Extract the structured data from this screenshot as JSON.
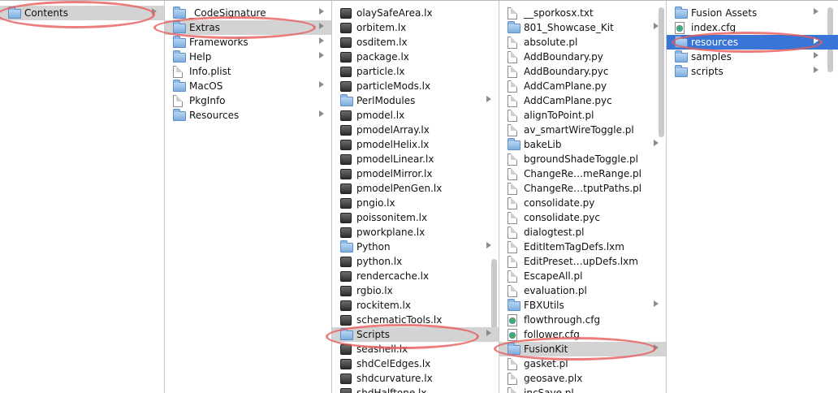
{
  "columns": [
    {
      "items": [
        {
          "label": "Contents",
          "icon": "folder-icon",
          "arrow": true,
          "selected": "gray"
        }
      ]
    },
    {
      "items": [
        {
          "label": "_CodeSignature",
          "icon": "folder-icon",
          "arrow": true
        },
        {
          "label": "Extras",
          "icon": "folder-icon",
          "arrow": true,
          "selected": "gray"
        },
        {
          "label": "Frameworks",
          "icon": "folder-icon",
          "arrow": true
        },
        {
          "label": "Help",
          "icon": "folder-icon",
          "arrow": true
        },
        {
          "label": "Info.plist",
          "icon": "doc-icon"
        },
        {
          "label": "MacOS",
          "icon": "folder-icon",
          "arrow": true
        },
        {
          "label": "PkgInfo",
          "icon": "doc-icon"
        },
        {
          "label": "Resources",
          "icon": "folder-icon",
          "arrow": true
        }
      ]
    },
    {
      "items": [
        {
          "label": "olaySafeArea.lx",
          "icon": "lx-icon"
        },
        {
          "label": "orbitem.lx",
          "icon": "lx-icon"
        },
        {
          "label": "osditem.lx",
          "icon": "lx-icon"
        },
        {
          "label": "package.lx",
          "icon": "lx-icon"
        },
        {
          "label": "particle.lx",
          "icon": "lx-icon"
        },
        {
          "label": "particleMods.lx",
          "icon": "lx-icon"
        },
        {
          "label": "PerlModules",
          "icon": "folder-icon",
          "arrow": true
        },
        {
          "label": "pmodel.lx",
          "icon": "lx-icon"
        },
        {
          "label": "pmodelArray.lx",
          "icon": "lx-icon"
        },
        {
          "label": "pmodelHelix.lx",
          "icon": "lx-icon"
        },
        {
          "label": "pmodelLinear.lx",
          "icon": "lx-icon"
        },
        {
          "label": "pmodelMirror.lx",
          "icon": "lx-icon"
        },
        {
          "label": "pmodelPenGen.lx",
          "icon": "lx-icon"
        },
        {
          "label": "pngio.lx",
          "icon": "lx-icon"
        },
        {
          "label": "poissonitem.lx",
          "icon": "lx-icon"
        },
        {
          "label": "pworkplane.lx",
          "icon": "lx-icon"
        },
        {
          "label": "Python",
          "icon": "folder-icon",
          "arrow": true
        },
        {
          "label": "python.lx",
          "icon": "lx-icon"
        },
        {
          "label": "rendercache.lx",
          "icon": "lx-icon"
        },
        {
          "label": "rgbio.lx",
          "icon": "lx-icon"
        },
        {
          "label": "rockitem.lx",
          "icon": "lx-icon"
        },
        {
          "label": "schematicTools.lx",
          "icon": "lx-icon"
        },
        {
          "label": "Scripts",
          "icon": "folder-icon",
          "arrow": true,
          "selected": "gray"
        },
        {
          "label": "seashell.lx",
          "icon": "lx-icon"
        },
        {
          "label": "shdCelEdges.lx",
          "icon": "lx-icon"
        },
        {
          "label": "shdcurvature.lx",
          "icon": "lx-icon"
        },
        {
          "label": "shdHalftone.lx",
          "icon": "lx-icon"
        }
      ]
    },
    {
      "items": [
        {
          "label": "__sporkosx.txt",
          "icon": "doc-icon"
        },
        {
          "label": "801_Showcase_Kit",
          "icon": "folder-icon",
          "arrow": true
        },
        {
          "label": "absolute.pl",
          "icon": "doc-icon"
        },
        {
          "label": "AddBoundary.py",
          "icon": "doc-icon"
        },
        {
          "label": "AddBoundary.pyc",
          "icon": "doc-icon"
        },
        {
          "label": "AddCamPlane.py",
          "icon": "doc-icon"
        },
        {
          "label": "AddCamPlane.pyc",
          "icon": "doc-icon"
        },
        {
          "label": "alignToPoint.pl",
          "icon": "doc-icon"
        },
        {
          "label": "av_smartWireToggle.pl",
          "icon": "doc-icon"
        },
        {
          "label": "bakeLib",
          "icon": "folder-icon",
          "arrow": true
        },
        {
          "label": "bgroundShadeToggle.pl",
          "icon": "doc-icon"
        },
        {
          "label": "ChangeRe…meRange.pl",
          "icon": "doc-icon"
        },
        {
          "label": "ChangeRe…tputPaths.pl",
          "icon": "doc-icon"
        },
        {
          "label": "consolidate.py",
          "icon": "doc-icon"
        },
        {
          "label": "consolidate.pyc",
          "icon": "doc-icon"
        },
        {
          "label": "dialogtest.pl",
          "icon": "doc-icon"
        },
        {
          "label": "EditItemTagDefs.lxm",
          "icon": "doc-icon"
        },
        {
          "label": "EditPreset…upDefs.lxm",
          "icon": "doc-icon"
        },
        {
          "label": "EscapeAll.pl",
          "icon": "doc-icon"
        },
        {
          "label": "evaluation.pl",
          "icon": "doc-icon"
        },
        {
          "label": "FBXUtils",
          "icon": "folder-icon",
          "arrow": true
        },
        {
          "label": "flowthrough.cfg",
          "icon": "cfg-icon"
        },
        {
          "label": "follower.cfg",
          "icon": "cfg-icon"
        },
        {
          "label": "FusionKit",
          "icon": "folder-icon",
          "arrow": true,
          "selected": "gray"
        },
        {
          "label": "gasket.pl",
          "icon": "doc-icon"
        },
        {
          "label": "geosave.plx",
          "icon": "doc-icon"
        },
        {
          "label": "incSave.pl",
          "icon": "doc-icon"
        }
      ]
    },
    {
      "items": [
        {
          "label": "Fusion Assets",
          "icon": "folder-icon",
          "arrow": true
        },
        {
          "label": "index.cfg",
          "icon": "cfg-icon"
        },
        {
          "label": "resources",
          "icon": "folder-icon",
          "arrow": true,
          "selected": "blue"
        },
        {
          "label": "samples",
          "icon": "folder-icon",
          "arrow": true
        },
        {
          "label": "scripts",
          "icon": "folder-icon",
          "arrow": true
        }
      ]
    }
  ],
  "colors": {
    "highlight_gray": "#d3d3d3",
    "highlight_blue": "#3875d7",
    "annotation": "#e85c5c"
  }
}
